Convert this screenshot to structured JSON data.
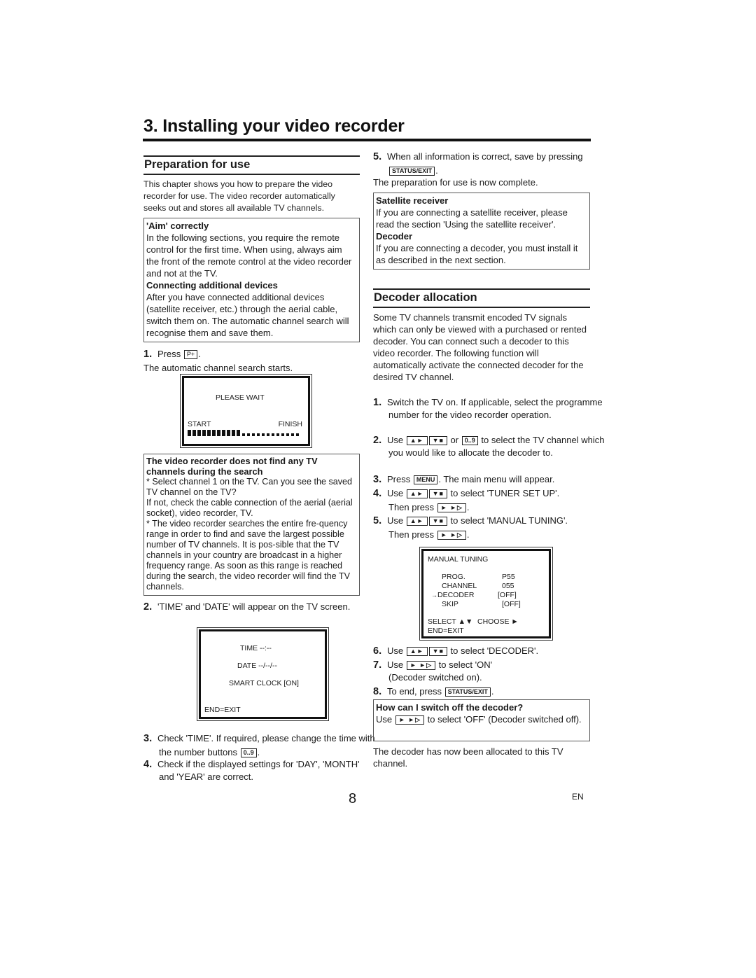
{
  "page": {
    "chapter_title": "3. Installing your video recorder",
    "page_number": "8",
    "language": "EN"
  },
  "preparation": {
    "heading": "Preparation for use",
    "intro": "This chapter shows you how to prepare the video recorder for use. The video recorder automatically seeks out and stores all available TV channels.",
    "note_box": {
      "aim_title": "'Aim' correctly",
      "aim_text": "In the following sections, you require the remote control for the first time. When using, always aim the front of the remote control at the video recorder and not at the TV.",
      "devices_title": "Connecting additional devices",
      "devices_text": "After you have connected additional devices (satellite receiver, etc.) through the aerial cable, switch them on. The automatic channel search will recognise them and save them."
    },
    "step1": {
      "num": "1.",
      "pre": "Press",
      "key": "P+",
      "post": "."
    },
    "step1_result": "The automatic channel search starts.",
    "search_screen": {
      "message": "PLEASE WAIT",
      "start_label": "START",
      "finish_label": "FINISH",
      "progress_filled": 11,
      "progress_total": 23,
      "progress_fraction": 0.48
    },
    "trouble_box": {
      "title": "The video recorder does not find any TV channels during the search",
      "text1": "* Select channel 1 on the TV. Can you see the saved TV channel on the TV?",
      "text2": "If not, check the cable connection of the aerial (aerial socket), video recorder, TV.",
      "text3": "* The video recorder searches the entire fre-quency range in order to find and save the largest possible number of TV channels. It is pos-sible that the TV channels in your country are broadcast in a higher frequency range. As soon as this range is reached during the search, the video recorder will find the TV channels."
    },
    "step2": {
      "num": "2.",
      "text": "'TIME' and 'DATE' will appear on the TV screen."
    },
    "clock_screen": {
      "time": "TIME --:--",
      "date": "DATE --/--/--",
      "smart_clock": "SMART CLOCK [ON]",
      "end": "END=EXIT"
    },
    "step3": {
      "num": "3.",
      "pre": "Check 'TIME'. If required, please change the time with the number buttons",
      "key": "0..9",
      "post": "."
    },
    "step4": {
      "num": "4.",
      "text": "Check if the displayed settings for 'DAY', 'MONTH' and 'YEAR' are correct."
    },
    "step5": {
      "num": "5.",
      "pre": "When all information is correct, save by pressing",
      "key": "STATUS/EXIT",
      "post": "."
    },
    "complete": "The preparation for use is now complete.",
    "info_box": {
      "sat_title": "Satellite receiver",
      "sat_text": "If you are connecting a satellite receiver, please read the section 'Using the satellite receiver'.",
      "dec_title": "Decoder",
      "dec_text": "If you are connecting a decoder, you must install it as described in the next section."
    }
  },
  "decoder": {
    "heading": "Decoder allocation",
    "intro": "Some TV channels transmit encoded TV signals which can only be viewed with a purchased or rented decoder. You can connect such a decoder to this video recorder. The following function will automatically activate the connected decoder for the desired TV channel.",
    "keys": {
      "up": "▲►",
      "down": "▼■",
      "digits": "0..9",
      "menu": "MENU",
      "forward": "► ►▷",
      "status_exit": "STATUS/EXIT"
    },
    "step1": {
      "num": "1.",
      "text": "Switch the TV on. If applicable, select the programme number for the video recorder operation."
    },
    "step2": {
      "num": "2.",
      "pre": "Use",
      "mid": "or",
      "post": "to select the TV channel which you would like to allocate the decoder to."
    },
    "step3": {
      "num": "3.",
      "pre": "Press",
      "post": ". The main menu will appear."
    },
    "step4": {
      "num": "4.",
      "pre": "Use",
      "post": "to select 'TUNER SET UP'.",
      "then": "Then press"
    },
    "step5": {
      "num": "5.",
      "pre": "Use",
      "post": "to select 'MANUAL TUNING'.",
      "then": "Then press"
    },
    "tuning_screen": {
      "title": "MANUAL TUNING",
      "rows": [
        {
          "label": "PROG.",
          "value": "P55",
          "selected": false
        },
        {
          "label": "CHANNEL",
          "value": "055",
          "selected": false
        },
        {
          "label": "DECODER",
          "value": "[OFF]",
          "selected": true
        },
        {
          "label": "SKIP",
          "value": "[OFF]",
          "selected": false
        }
      ],
      "cursor": "→",
      "select_hint": "SELECT ▲▼",
      "choose_hint": "CHOOSE ►",
      "end": "END=EXIT"
    },
    "step6": {
      "num": "6.",
      "pre": "Use",
      "post": "to select 'DECODER'."
    },
    "step7": {
      "num": "7.",
      "pre": "Use",
      "post": "to select 'ON'",
      "note": "(Decoder switched on)."
    },
    "step8": {
      "num": "8.",
      "pre": "To end, press",
      "post": "."
    },
    "off_box": {
      "title": "How can I switch off the decoder?",
      "pre": "Use",
      "post": "to select 'OFF' (Decoder switched off)."
    },
    "outro": "The decoder has now been allocated to this TV channel."
  }
}
